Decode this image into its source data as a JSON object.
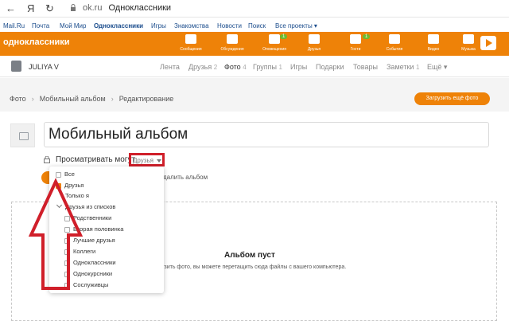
{
  "browser": {
    "back_glyph": "←",
    "yandex_glyph": "Я",
    "reload_glyph": "↻",
    "domain": "ok.ru",
    "page_title": "Одноклассники"
  },
  "portal_nav": {
    "items": [
      "Mail.Ru",
      "Почта",
      "Мой Мир",
      "Одноклассники",
      "Игры",
      "Знакомства",
      "Новости",
      "Поиск",
      "Все проекты ▾"
    ]
  },
  "header": {
    "logo": "одноклассники",
    "icons": [
      {
        "label": "Сообщения",
        "icon": "envelope-icon"
      },
      {
        "label": "Обсуждения",
        "icon": "chat-icon"
      },
      {
        "label": "Оповещения",
        "icon": "bell-icon",
        "badge": "1"
      },
      {
        "label": "Друзья",
        "icon": "friends-icon"
      },
      {
        "label": "Гости",
        "icon": "footprints-icon",
        "badge": "1"
      },
      {
        "label": "События",
        "icon": "ruble-icon"
      },
      {
        "label": "Видео",
        "icon": "video-icon"
      },
      {
        "label": "Музыка",
        "icon": "music-icon"
      }
    ],
    "accent_color": "#ee8208"
  },
  "profile": {
    "username": "JULIYA V",
    "tabs": [
      {
        "label": "Лента",
        "count": ""
      },
      {
        "label": "Друзья",
        "count": "2"
      },
      {
        "label": "Фото",
        "count": "4"
      },
      {
        "label": "Группы",
        "count": "1"
      },
      {
        "label": "Игры",
        "count": ""
      },
      {
        "label": "Подарки",
        "count": ""
      },
      {
        "label": "Товары",
        "count": ""
      },
      {
        "label": "Заметки",
        "count": "1"
      },
      {
        "label": "Ещё ▾",
        "count": ""
      }
    ]
  },
  "breadcrumb": [
    "Фото",
    "Мобильный альбом",
    "Редактирование"
  ],
  "upload_more": "Загрузить ещё фото",
  "album": {
    "name": "Мобильный альбом",
    "privacy_label": "Просматривать могут",
    "privacy_value": "Друзья",
    "delete_label": "далить альбом"
  },
  "empty": {
    "title": "Альбом пуст",
    "hint": "узить фото, вы можете перетащить сюда файлы с вашего компьютера."
  },
  "dropdown": {
    "all": "Все",
    "friends": "Друзья",
    "only_me": "Только я",
    "from_lists": "Друзья из списков",
    "lists": [
      "Родственники",
      "Вторая половинка",
      "Лучшие друзья",
      "Коллеги",
      "Одноклассники",
      "Однокурсники",
      "Сослуживцы"
    ]
  }
}
